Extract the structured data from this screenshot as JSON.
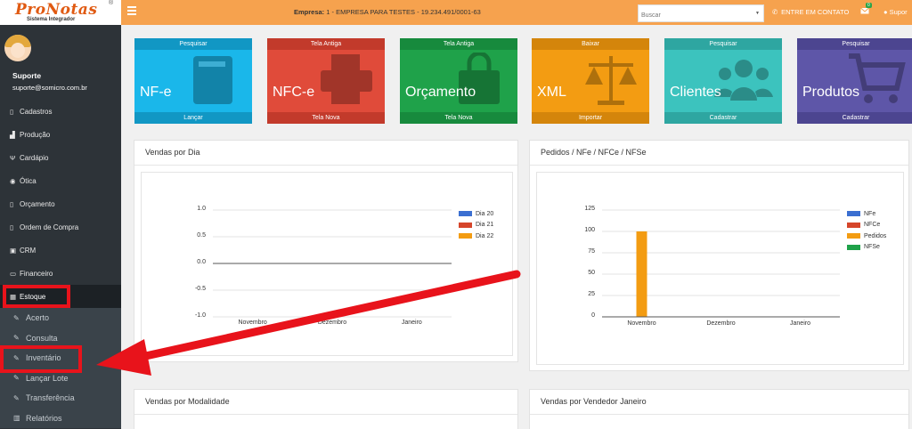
{
  "header": {
    "logo_text": "ProNotas",
    "logo_reg": "®",
    "logo_sub": "Sistema Integrador",
    "empresa_label": "Empresa:",
    "empresa_value": "1 - EMPRESA PARA TESTES - 19.234.491/0001-63",
    "search_placeholder": "Buscar",
    "contato_label": "ENTRE EM CONTATO",
    "msg_badge": "0",
    "user_label": "Supor"
  },
  "sidebar": {
    "user_name": "Suporte",
    "user_email": "suporte@somicro.com.br",
    "items": [
      {
        "label": "Cadastros",
        "icon": "file-icon"
      },
      {
        "label": "Produção",
        "icon": "industry-icon"
      },
      {
        "label": "Cardápio",
        "icon": "cutlery-icon"
      },
      {
        "label": "Ótica",
        "icon": "eye-icon"
      },
      {
        "label": "Orçamento",
        "icon": "file-icon"
      },
      {
        "label": "Ordem de Compra",
        "icon": "file-icon"
      },
      {
        "label": "CRM",
        "icon": "id-card-icon"
      },
      {
        "label": "Financeiro",
        "icon": "money-icon"
      },
      {
        "label": "Estoque",
        "icon": "cubes-icon"
      }
    ],
    "submenu": [
      {
        "label": "Acerto",
        "icon": "edit-icon"
      },
      {
        "label": "Consulta",
        "icon": "edit-icon"
      },
      {
        "label": "Inventário",
        "icon": "edit-icon"
      },
      {
        "label": "Lançar Lote",
        "icon": "edit-icon"
      },
      {
        "label": "Transferência",
        "icon": "edit-icon"
      },
      {
        "label": "Relatórios",
        "icon": "bar-chart-icon"
      }
    ]
  },
  "tiles": [
    {
      "top": "Pesquisar",
      "title": "NF-e",
      "bottom": "Lançar",
      "color": "#1ab7ea",
      "dark": "#1197c4",
      "icon": "book-icon"
    },
    {
      "top": "Tela Antiga",
      "title": "NFC-e",
      "bottom": "Tela Nova",
      "color": "#e04b3a",
      "dark": "#c23a2b",
      "icon": "printer-icon"
    },
    {
      "top": "Tela Antiga",
      "title": "Orçamento",
      "bottom": "Tela Nova",
      "color": "#1fa24a",
      "dark": "#178a3d",
      "icon": "shopping-bag-icon"
    },
    {
      "top": "Baixar",
      "title": "XML",
      "bottom": "Importar",
      "color": "#f39c12",
      "dark": "#d4850b",
      "icon": "balance-scale-icon"
    },
    {
      "top": "Pesquisar",
      "title": "Clientes",
      "bottom": "Cadastrar",
      "color": "#3cc3be",
      "dark": "#2ea6a1",
      "icon": "users-icon"
    },
    {
      "top": "Pesquisar",
      "title": "Produtos",
      "bottom": "Cadastrar",
      "color": "#5e56a8",
      "dark": "#4c4590",
      "icon": "cart-icon"
    }
  ],
  "panels": {
    "vendas_dia": "Vendas por Dia",
    "pedidos": "Pedidos / NFe / NFCe / NFSe",
    "modalidade": "Vendas por Modalidade",
    "vendedor": "Vendas por Vendedor Janeiro"
  },
  "colors": {
    "topbar": "#f6a24e",
    "sidebar": "#2d3338",
    "annotation": "#e8131b"
  },
  "chart_data": [
    {
      "type": "line",
      "title": "Vendas por Dia",
      "categories": [
        "Novembro",
        "Dezembro",
        "Janeiro"
      ],
      "yticks": [
        "1.0",
        "0.5",
        "0.0",
        "-0.5",
        "-1.0"
      ],
      "ylim": [
        -1.0,
        1.0
      ],
      "series": [
        {
          "name": "Dia 20",
          "values": [
            0,
            0,
            0
          ],
          "color": "#3b6fd1"
        },
        {
          "name": "Dia 21",
          "values": [
            0,
            0,
            0
          ],
          "color": "#d6452a"
        },
        {
          "name": "Dia 22",
          "values": [
            0,
            0,
            0
          ],
          "color": "#f39c12"
        }
      ],
      "legend": "right"
    },
    {
      "type": "bar",
      "title": "Pedidos / NFe / NFCe / NFSe",
      "categories": [
        "Novembro",
        "Dezembro",
        "Janeiro"
      ],
      "yticks": [
        "125",
        "100",
        "75",
        "50",
        "25",
        "0"
      ],
      "ylim": [
        0,
        125
      ],
      "series": [
        {
          "name": "NFe",
          "values": [
            0,
            0,
            0
          ],
          "color": "#3b6fd1"
        },
        {
          "name": "NFCe",
          "values": [
            0,
            0,
            0
          ],
          "color": "#d6452a"
        },
        {
          "name": "Pedidos",
          "values": [
            100,
            0,
            0
          ],
          "color": "#f39c12"
        },
        {
          "name": "NFSe",
          "values": [
            0,
            0,
            0
          ],
          "color": "#1fa24a"
        }
      ],
      "legend": "right"
    }
  ]
}
